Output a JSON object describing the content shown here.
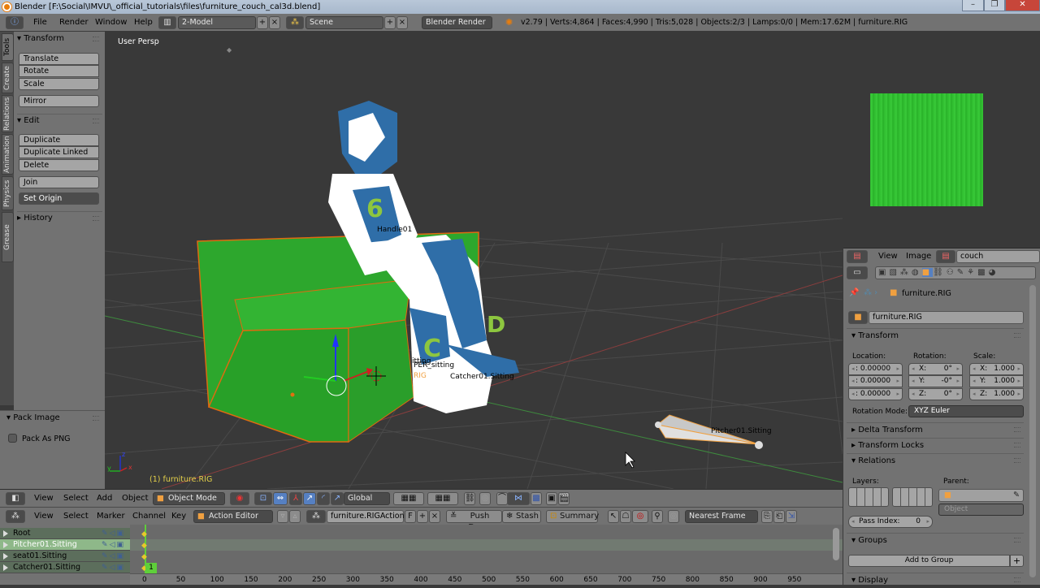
{
  "window": {
    "title": "Blender [F:\\Social\\IMVU\\_official_tutorials\\files\\furniture_couch_cal3d.blend]",
    "controls": {
      "minimize": "–",
      "maximize": "❐",
      "close": "✕"
    }
  },
  "menubar": {
    "menus": [
      "File",
      "Render",
      "Window",
      "Help"
    ],
    "screen_layout": "2-Model",
    "scene": "Scene",
    "render_engine": "Blender Render",
    "stats": "v2.79 | Verts:4,864 | Faces:4,990 | Tris:5,028 | Objects:2/3 | Lamps:0/0 | Mem:17.62M | furniture.RIG"
  },
  "tool_tabs": [
    "Tools",
    "Create",
    "Relations",
    "Animation",
    "Physics",
    "Grease Pencil"
  ],
  "toolshelf": {
    "transform_header": "Transform",
    "transform_buttons": [
      "Translate",
      "Rotate",
      "Scale"
    ],
    "mirror": "Mirror",
    "edit_header": "Edit",
    "edit_buttons": [
      "Duplicate",
      "Duplicate Linked",
      "Delete"
    ],
    "join": "Join",
    "set_origin": "Set Origin",
    "history_header": "History",
    "pack_image_header": "Pack Image",
    "pack_as_png": "Pack As PNG",
    "pack_as_png_checked": false
  },
  "viewport": {
    "view_label": "User Persp",
    "object_info": "(1) furniture.RIG",
    "labels": {
      "handle": "Handle01",
      "sitting": "itting",
      "per_sitting": "PER_sitting",
      "rig": "RIG",
      "catcher": "Catcher01.Sitting",
      "pitcher": "Pitcher01.Sitting"
    },
    "axis": {
      "x": "x",
      "y": "y",
      "z": "z"
    }
  },
  "viewport_header": {
    "menus": [
      "View",
      "Select",
      "Add",
      "Object"
    ],
    "mode": "Object Mode",
    "orientation": "Global"
  },
  "action_editor": {
    "menus": [
      "View",
      "Select",
      "Marker",
      "Channel",
      "Key"
    ],
    "mode": "Action Editor",
    "action": "furniture.RIGAction",
    "fake_user": "F",
    "push_down": "Push Down",
    "stash": "Stash",
    "summary": "Summary",
    "snap": "Nearest Frame",
    "channels": [
      {
        "name": "Root",
        "selected": false
      },
      {
        "name": "Pitcher01.Sitting",
        "selected": true
      },
      {
        "name": "seat01.Sitting",
        "selected": false
      },
      {
        "name": "Catcher01.Sitting",
        "selected": false
      }
    ],
    "current_frame": "1",
    "ruler_ticks": [
      "0",
      "50",
      "100",
      "150",
      "200",
      "250",
      "300",
      "350",
      "400",
      "450",
      "500",
      "550",
      "600",
      "650",
      "700",
      "750",
      "800",
      "850",
      "900",
      "950"
    ]
  },
  "image_editor": {
    "menus": [
      "View",
      "Image"
    ],
    "image_name": "couch",
    "texture_color": "#2fbe2f"
  },
  "properties": {
    "breadcrumb": "furniture.RIG",
    "object_name": "furniture.RIG",
    "transform_header": "Transform",
    "location_label": "Location:",
    "rotation_label": "Rotation:",
    "scale_label": "Scale:",
    "location": [
      ": 0.00000",
      ": 0.00000",
      ": 0.00000"
    ],
    "rotation": [
      {
        "axis": "X:",
        "value": "0°"
      },
      {
        "axis": "Y:",
        "value": "-0°"
      },
      {
        "axis": "Z:",
        "value": "0°"
      }
    ],
    "scale": [
      {
        "axis": "X:",
        "value": "1.000"
      },
      {
        "axis": "Y:",
        "value": "1.000"
      },
      {
        "axis": "Z:",
        "value": "1.000"
      }
    ],
    "rotation_mode_label": "Rotation Mode:",
    "rotation_mode": "XYZ Euler",
    "delta_transform": "Delta Transform",
    "transform_locks": "Transform Locks",
    "relations": "Relations",
    "layers_label": "Layers:",
    "parent_label": "Parent:",
    "parent_type": "Object",
    "pass_index_label": "Pass Index:",
    "pass_index": "0",
    "groups": "Groups",
    "add_to_group": "Add to Group",
    "display": "Display"
  }
}
